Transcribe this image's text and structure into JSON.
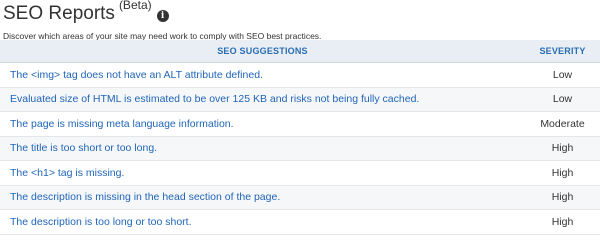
{
  "header": {
    "title": "SEO Reports",
    "beta_label": "(Beta)",
    "subtitle": "Discover which areas of your site may need work to comply with SEO best practices."
  },
  "table": {
    "columns": {
      "suggestion": "SEO SUGGESTIONS",
      "severity": "SEVERITY"
    },
    "rows": [
      {
        "suggestion": "The <img> tag does not have an ALT attribute defined.",
        "severity": "Low"
      },
      {
        "suggestion": "Evaluated size of HTML is estimated to be over 125 KB and risks not being fully cached.",
        "severity": "Low"
      },
      {
        "suggestion": "The page is missing meta language information.",
        "severity": "Moderate"
      },
      {
        "suggestion": "The title is too short or too long.",
        "severity": "High"
      },
      {
        "suggestion": "The <h1> tag is missing.",
        "severity": "High"
      },
      {
        "suggestion": "The description is missing in the head section of the page.",
        "severity": "High"
      },
      {
        "suggestion": "The description is too long or too short.",
        "severity": "High"
      }
    ]
  },
  "colors": {
    "link": "#1f64b8",
    "header_text": "#2a6db5",
    "header_bg": "#e8eef3",
    "alt_row_bg": "#f6f7f8"
  },
  "icons": {
    "info": "info-icon"
  }
}
